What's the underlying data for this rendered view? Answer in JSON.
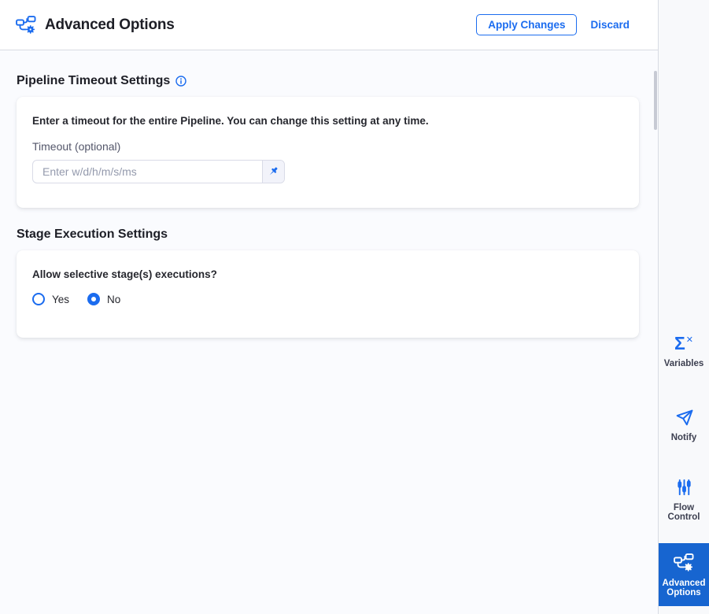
{
  "header": {
    "icon": "pipeline-gear-icon",
    "title": "Advanced Options",
    "apply_button": "Apply Changes",
    "discard_button": "Discard"
  },
  "timeout_section": {
    "heading": "Pipeline Timeout Settings",
    "info_icon": "info-circle-icon",
    "description": "Enter a timeout for the entire Pipeline. You can change this setting at any time.",
    "timeout_label": "Timeout (optional)",
    "timeout_placeholder": "Enter w/d/h/m/s/ms",
    "pin_icon": "pushpin-icon"
  },
  "stage_execution": {
    "heading": "Stage Execution Settings",
    "question": "Allow selective stage(s) executions?",
    "options": [
      {
        "label": "Yes",
        "selected": false
      },
      {
        "label": "No",
        "selected": true
      }
    ]
  },
  "sidebar": {
    "items": [
      {
        "label": "Variables",
        "icon": "sigma-x-icon",
        "active": false
      },
      {
        "label": "Notify",
        "icon": "paper-plane-icon",
        "active": false
      },
      {
        "label": "Flow Control",
        "icon": "sliders-icon",
        "active": false
      },
      {
        "label": "Advanced Options",
        "icon": "pipeline-gear-icon",
        "active": true
      }
    ]
  },
  "colors": {
    "accent_blue": "#1b6cef",
    "active_tile_blue": "#1765d0",
    "heading_text": "#1d1e26",
    "body_text": "#26272e",
    "muted_label": "#53566a",
    "placeholder": "#949aad",
    "border": "#d9dbe7"
  }
}
